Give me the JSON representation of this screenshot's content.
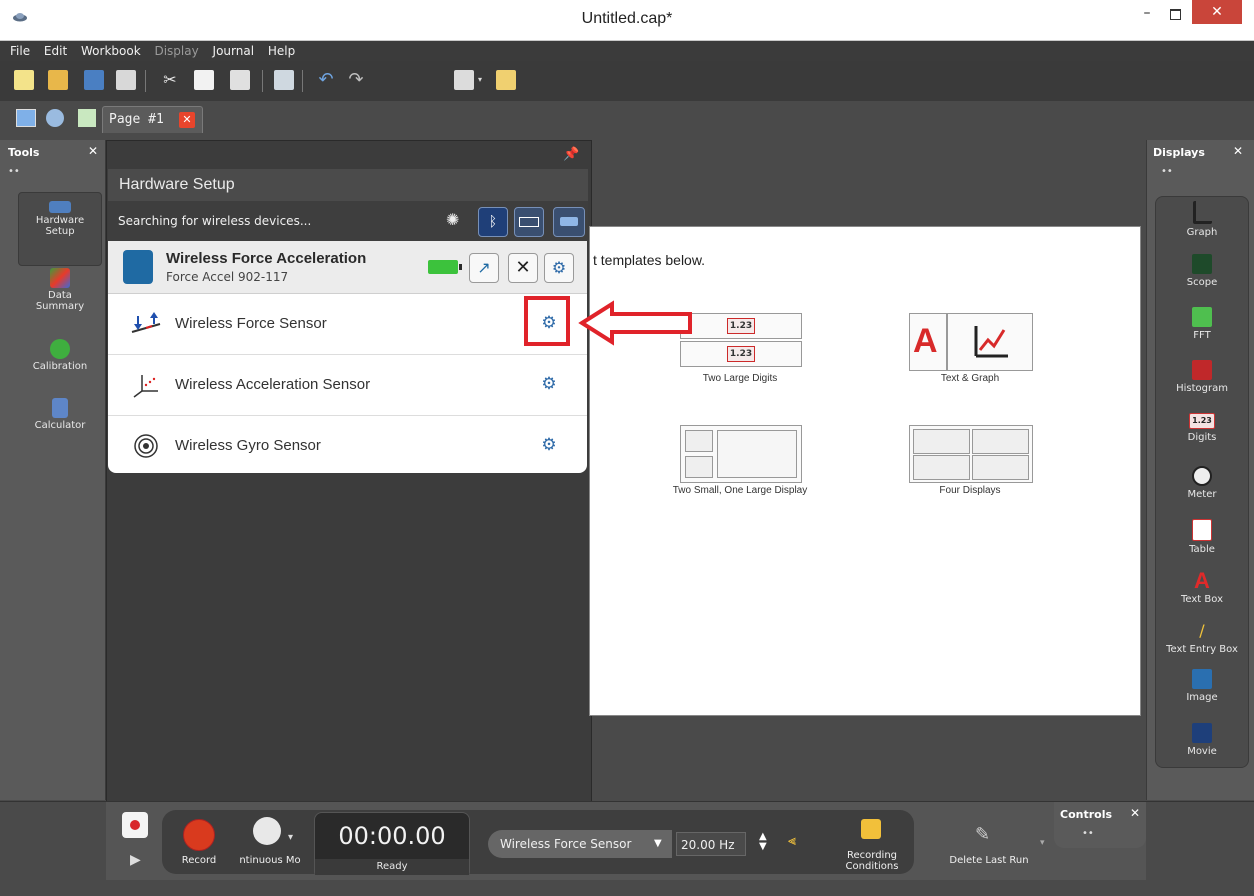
{
  "window": {
    "title": "Untitled.cap*",
    "minimize": "–",
    "close": "✕"
  },
  "menu": [
    "File",
    "Edit",
    "Workbook",
    "Display",
    "Journal",
    "Help"
  ],
  "tabs": {
    "page_label": "Page #1",
    "close": "✕"
  },
  "tools": {
    "header": "Tools",
    "close": "✕",
    "dots": "••",
    "items": [
      {
        "label": "Hardware\nSetup",
        "icon": "hardware-icon"
      },
      {
        "label": "Data\nSummary",
        "icon": "data-summary-icon"
      },
      {
        "label": "Calibration",
        "icon": "calibration-icon"
      },
      {
        "label": "Calculator",
        "icon": "calculator-icon"
      }
    ]
  },
  "hardware_setup": {
    "title": "Hardware Setup",
    "search_text": "Searching for wireless devices...",
    "device": {
      "name": "Wireless Force Acceleration",
      "subtitle": "Force Accel 902-117"
    },
    "sensors": [
      {
        "label": "Wireless Force Sensor",
        "icon": "force-sensor-icon"
      },
      {
        "label": "Wireless Acceleration Sensor",
        "icon": "acceleration-sensor-icon"
      },
      {
        "label": "Wireless Gyro Sensor",
        "icon": "gyro-sensor-icon"
      }
    ]
  },
  "page": {
    "instruction": "t templates below.",
    "templates": [
      {
        "label": "Two Large Digits",
        "digits": [
          "1.23",
          "1.23"
        ]
      },
      {
        "label": "Text & Graph",
        "text_glyph": "A"
      },
      {
        "label": "Two Small, One Large Display"
      },
      {
        "label": "Four Displays"
      }
    ]
  },
  "displays": {
    "header": "Displays",
    "close": "✕",
    "dots": "••",
    "items": [
      {
        "label": "Graph",
        "icon": "graph-icon"
      },
      {
        "label": "Scope",
        "icon": "scope-icon"
      },
      {
        "label": "FFT",
        "icon": "fft-icon"
      },
      {
        "label": "Histogram",
        "icon": "histogram-icon"
      },
      {
        "label": "Digits",
        "icon": "digits-icon",
        "glyph": "1.23"
      },
      {
        "label": "Meter",
        "icon": "meter-icon"
      },
      {
        "label": "Table",
        "icon": "table-icon"
      },
      {
        "label": "Text Box",
        "icon": "text-box-icon",
        "glyph": "A"
      },
      {
        "label": "Text Entry Box",
        "icon": "text-entry-icon"
      },
      {
        "label": "Image",
        "icon": "image-icon"
      },
      {
        "label": "Movie",
        "icon": "movie-icon"
      }
    ]
  },
  "controls": {
    "header": "Controls",
    "close": "✕",
    "dots": "••",
    "record_label": "Record",
    "mode_label": "ntinuous Mo",
    "timer": "00:00.00",
    "status": "Ready",
    "sensor": "Wireless Force Sensor",
    "rate": "20.00 Hz",
    "recording_conditions": "Recording\nConditions",
    "delete_last_run": "Delete Last Run"
  },
  "colors": {
    "accent_red": "#e0232a",
    "bluetooth_blue": "#1f5fbf",
    "battery_green": "#3cc23c"
  }
}
